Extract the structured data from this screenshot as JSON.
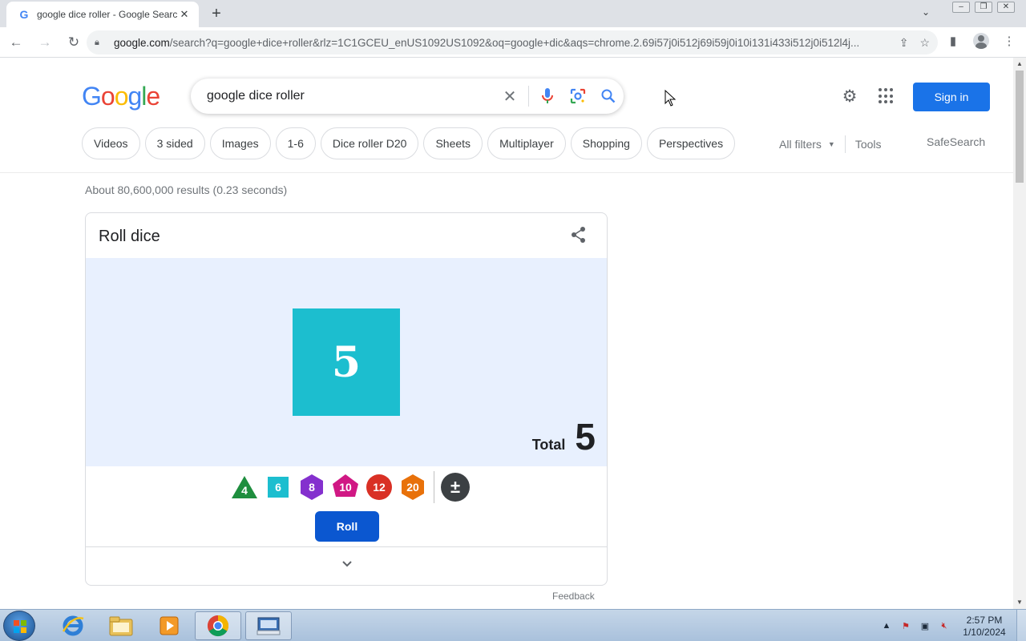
{
  "browser": {
    "tab_title": "google dice roller - Google Search",
    "tab_close": "✕",
    "new_tab": "+",
    "url_host": "google.com",
    "url_rest": "/search?q=google+dice+roller&rlz=1C1GCEU_enUS1092US1092&oq=google+dic&aqs=chrome.2.69i57j0i512j69i59j0i10i131i433i512j0i512l4j..."
  },
  "search": {
    "logo_letters": [
      "G",
      "o",
      "o",
      "g",
      "l",
      "e"
    ],
    "query": "google dice roller",
    "sign_in": "Sign in"
  },
  "chips": [
    "Videos",
    "3 sided",
    "Images",
    "1-6",
    "Dice roller D20",
    "Sheets",
    "Multiplayer",
    "Shopping",
    "Perspectives"
  ],
  "filters": {
    "all_filters": "All filters",
    "tools": "Tools",
    "safesearch": "SafeSearch"
  },
  "stats": "About 80,600,000 results (0.23 seconds)",
  "dice_card": {
    "title": "Roll dice",
    "rolled_value": "5",
    "total_label": "Total",
    "total_value": "5",
    "dice": [
      {
        "label": "4",
        "shape": "triangle",
        "color": "#1e8e3e"
      },
      {
        "label": "6",
        "shape": "square",
        "color": "#1cbecf"
      },
      {
        "label": "8",
        "shape": "hexagon",
        "color": "#8430ce"
      },
      {
        "label": "10",
        "shape": "diamond",
        "color": "#d01884"
      },
      {
        "label": "12",
        "shape": "circle",
        "color": "#d93025"
      },
      {
        "label": "20",
        "shape": "hexagon",
        "color": "#e8710a"
      }
    ],
    "modifier": "±",
    "roll_button": "Roll",
    "feedback": "Feedback"
  },
  "taskbar": {
    "time": "2:57 PM",
    "date": "1/10/2024"
  },
  "colors": {
    "accent": "#1a73e8",
    "roll_button": "#0b57d0",
    "dice_area_bg": "#e8f0fe",
    "d6_face": "#1cbecf"
  }
}
